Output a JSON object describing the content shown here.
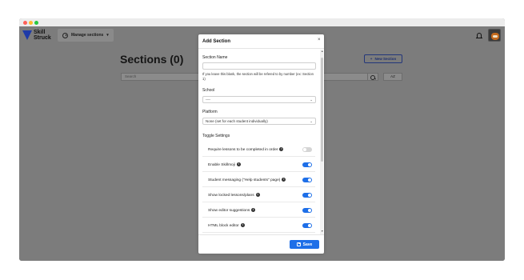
{
  "browser": {
    "dots": [
      "close",
      "minimize",
      "maximize"
    ]
  },
  "header": {
    "logo_text": "Skill Struck",
    "manage_label": "Manage sections",
    "manage_caret": "▾"
  },
  "page": {
    "title": "Sections (0)",
    "new_section_label": "New Section",
    "new_section_icon": "+",
    "search_placeholder": "Search",
    "sort_label": "AZ"
  },
  "modal": {
    "title": "Add Section",
    "close": "×",
    "section_name_label": "Section Name",
    "section_name_value": "",
    "section_name_help": "If you leave this blank, the section will be refered to by number (ex: Section 1)",
    "school_label": "School",
    "school_value": "----",
    "platform_label": "Platform",
    "platform_value": "None (set for each student individually)",
    "toggle_settings_label": "Toggle Settings",
    "toggles": [
      {
        "label": "Require lessons to be completed in order",
        "on": false
      },
      {
        "label": "Enable Skillmoji",
        "on": true
      },
      {
        "label": "Student messaging (\"Help students\" page)",
        "on": true
      },
      {
        "label": "Show locked lessons/plans",
        "on": true
      },
      {
        "label": "Show editor suggestions",
        "on": true
      },
      {
        "label": "HTML block editor",
        "on": true
      }
    ],
    "info_glyph": "i",
    "save_label": "Save"
  },
  "colors": {
    "accent": "#1e6fe8",
    "overlay": "#7c7c7c",
    "logo_blue": "#1e3aa8"
  }
}
